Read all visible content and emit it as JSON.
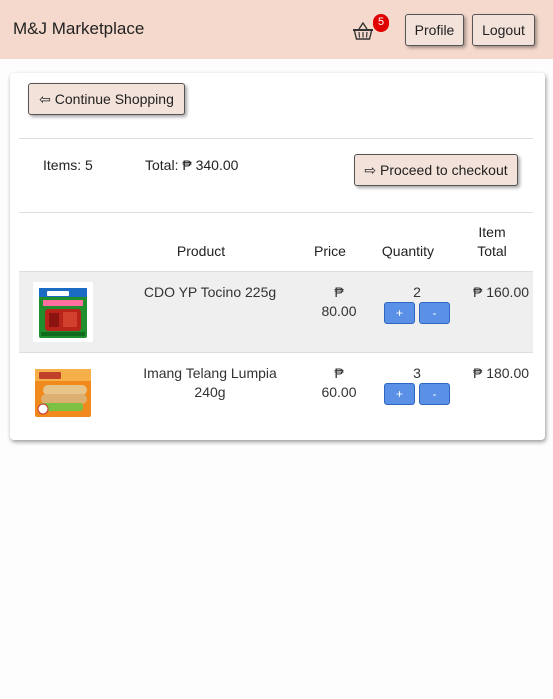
{
  "navbar": {
    "brand": "M&J Marketplace",
    "cart_icon": "basket-icon",
    "cart_count": "5",
    "profile_label": "Profile",
    "logout_label": "Logout"
  },
  "cart": {
    "continue_label": "⇦ Continue Shopping",
    "items_label": "Items: 5",
    "total_label": "Total: ₱ 340.00",
    "checkout_label": "⇨ Proceed to checkout",
    "columns": {
      "product": "Product",
      "price": "Price",
      "quantity": "Quantity",
      "item_total_line1": "Item",
      "item_total_line2": "Total"
    },
    "rows": [
      {
        "name": "CDO YP Tocino 225g",
        "price_symbol": "₱",
        "price_value": "80.00",
        "quantity": "2",
        "item_total": "₱ 160.00",
        "plus_label": "+",
        "minus_label": "-",
        "image": "tocino-pack-image"
      },
      {
        "name_line1": "Imang Telang Lumpia",
        "name_line2": "240g",
        "price_symbol": "₱",
        "price_value": "60.00",
        "quantity": "3",
        "item_total": "₱ 180.00",
        "plus_label": "+",
        "minus_label": "-",
        "image": "lumpia-pack-image"
      }
    ]
  },
  "colors": {
    "navbar_bg": "#f5d9cc",
    "button_bg": "#f2e2da",
    "qty_button": "#5a90e6",
    "badge": "#e00000",
    "row_alt": "#efefef"
  }
}
